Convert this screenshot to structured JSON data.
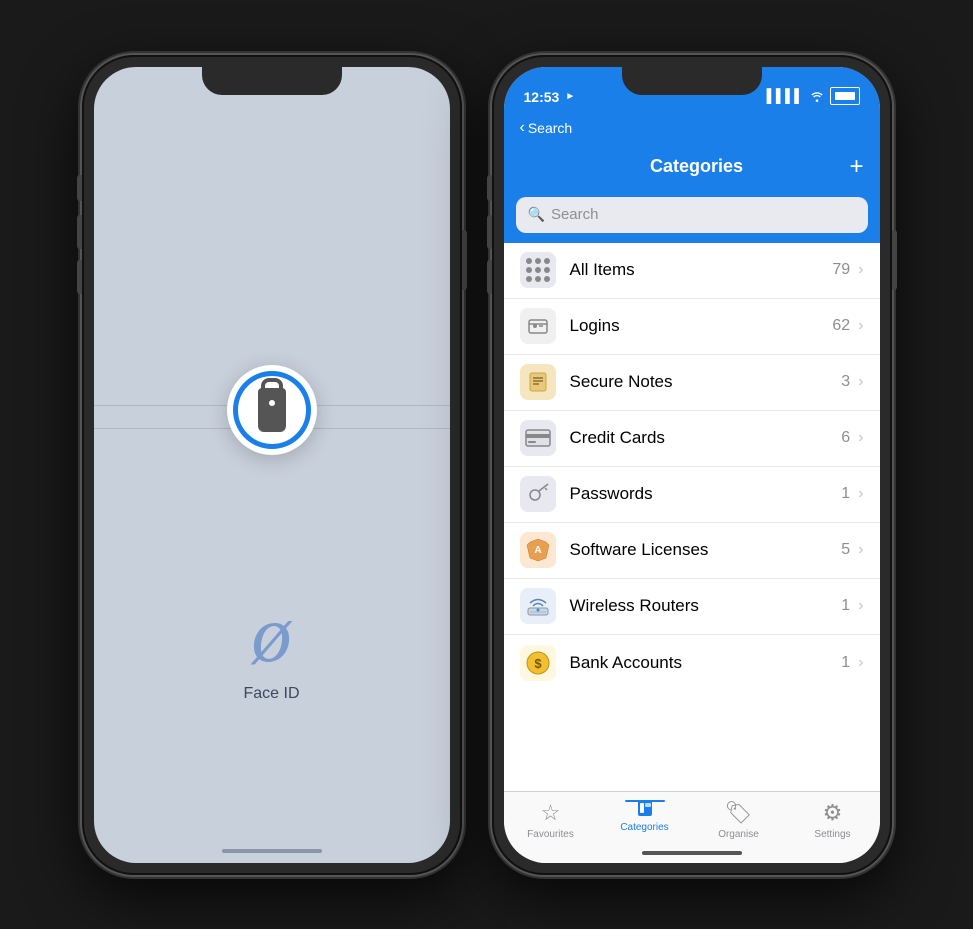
{
  "left_phone": {
    "face_id_label": "Face ID",
    "face_id_char": "ø"
  },
  "right_phone": {
    "status": {
      "time": "12:53",
      "location_icon": "▲",
      "signal": "●●●●",
      "wifi": "wifi",
      "battery": "🔋"
    },
    "nav": {
      "back_label": "Search",
      "back_chevron": "‹"
    },
    "title": {
      "text": "Categories",
      "plus": "+"
    },
    "search": {
      "placeholder": "Search"
    },
    "categories": [
      {
        "id": "all-items",
        "label": "All Items",
        "count": "79",
        "icon_type": "allitems"
      },
      {
        "id": "logins",
        "label": "Logins",
        "count": "62",
        "icon_type": "logins"
      },
      {
        "id": "secure-notes",
        "label": "Secure Notes",
        "count": "3",
        "icon_type": "securenotes"
      },
      {
        "id": "credit-cards",
        "label": "Credit Cards",
        "count": "6",
        "icon_type": "creditcards"
      },
      {
        "id": "passwords",
        "label": "Passwords",
        "count": "1",
        "icon_type": "passwords"
      },
      {
        "id": "software-licenses",
        "label": "Software Licenses",
        "count": "5",
        "icon_type": "software"
      },
      {
        "id": "wireless-routers",
        "label": "Wireless Routers",
        "count": "1",
        "icon_type": "wireless"
      },
      {
        "id": "bank-accounts",
        "label": "Bank Accounts",
        "count": "1",
        "icon_type": "bank"
      }
    ],
    "tabs": [
      {
        "id": "favourites",
        "label": "Favourites",
        "icon": "★",
        "active": false
      },
      {
        "id": "categories",
        "label": "Categories",
        "icon": "📱",
        "active": true
      },
      {
        "id": "organise",
        "label": "Organise",
        "icon": "🏷",
        "active": false
      },
      {
        "id": "settings",
        "label": "Settings",
        "icon": "⚙",
        "active": false
      }
    ]
  }
}
